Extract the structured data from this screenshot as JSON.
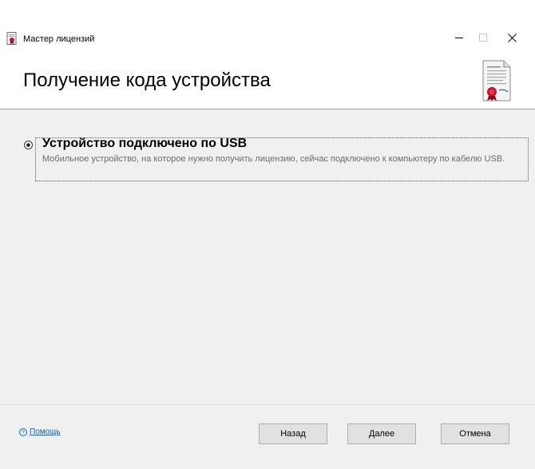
{
  "window": {
    "title": "Мастер лицензий",
    "minimize_symbol": "–",
    "maximize_symbol": "□",
    "close_symbol": "✕"
  },
  "header": {
    "title": "Получение кода устройства",
    "icon": "certificate-document-icon"
  },
  "option": {
    "selected": true,
    "title": "Устройство подключено по USB",
    "description": "Мобильное устройство, на которое нужно получить лицензию, сейчас подключено к компьютеру по кабелю USB."
  },
  "footer": {
    "help_label": "Помощь",
    "back_label": "Назад",
    "next_label": "Далее",
    "cancel_label": "Отмена"
  },
  "colors": {
    "link": "#0066cc",
    "description_text": "#6b6b6b",
    "window_bg": "#f0f0f0"
  }
}
